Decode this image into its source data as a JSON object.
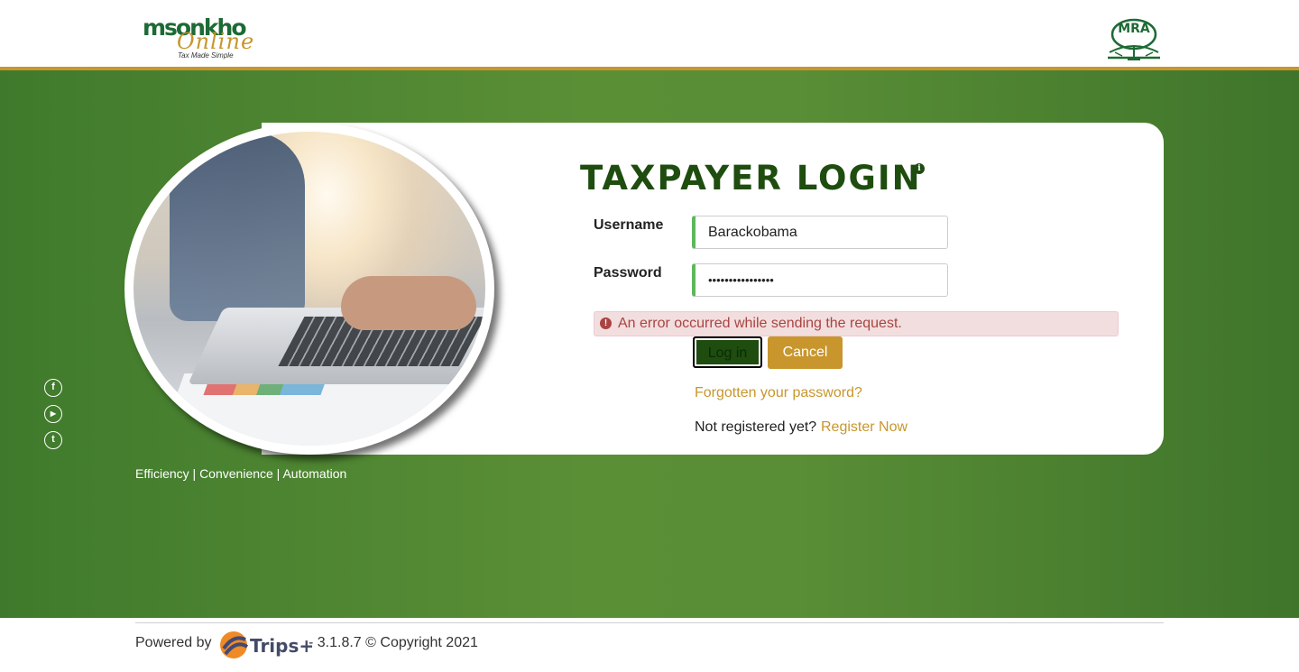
{
  "header": {
    "brand_top": "msonkho",
    "brand_script": "Online",
    "brand_tagline": "Tax Made Simple",
    "mra_logo_text": "MRA"
  },
  "login": {
    "title": "TAXPAYER LOGIN",
    "info_icon": "i",
    "username_label": "Username",
    "username_value": "Barackobama",
    "password_label": "Password",
    "password_value": "••••••••••••••••",
    "error_icon": "!",
    "error_message": "An error occurred while sending the request.",
    "login_button": "Log in",
    "cancel_button": "Cancel",
    "forgot_link": "Forgotten your password?",
    "not_registered_text": "Not registered yet?",
    "register_link": "Register Now"
  },
  "social": {
    "facebook": "f",
    "youtube": "▶",
    "twitter": "t"
  },
  "tagline": "Efficiency | Convenience | Automation",
  "footer": {
    "powered_by": "Powered by",
    "trips_brand": "Trips+",
    "version_copyright": "- 3.1.8.7 © Copyright 2021"
  },
  "colors": {
    "brand_green": "#1e4d0f",
    "accent_gold": "#c8962d",
    "band_green": "#5b8f36",
    "error_red": "#a94442"
  }
}
